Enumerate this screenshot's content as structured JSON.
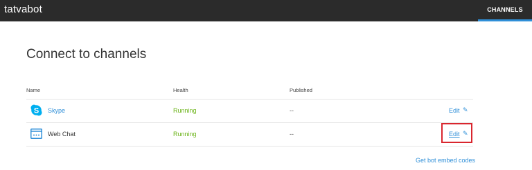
{
  "app": {
    "title": "tatvabot"
  },
  "nav": {
    "active_tab": "CHANNELS"
  },
  "page": {
    "title": "Connect to channels"
  },
  "table": {
    "columns": [
      "Name",
      "Health",
      "Published"
    ],
    "rows": [
      {
        "name": "Skype",
        "health": "Running",
        "published": "--",
        "action": "Edit",
        "icon": "skype-icon"
      },
      {
        "name": "Web Chat",
        "health": "Running",
        "published": "--",
        "action": "Edit",
        "icon": "web-chat-icon"
      }
    ]
  },
  "footer": {
    "embed_link": "Get bot embed codes"
  },
  "colors": {
    "accent": "#2f8fd8",
    "running": "#6ab316",
    "topbar": "#2b2b2b",
    "highlight": "#d9262e"
  }
}
